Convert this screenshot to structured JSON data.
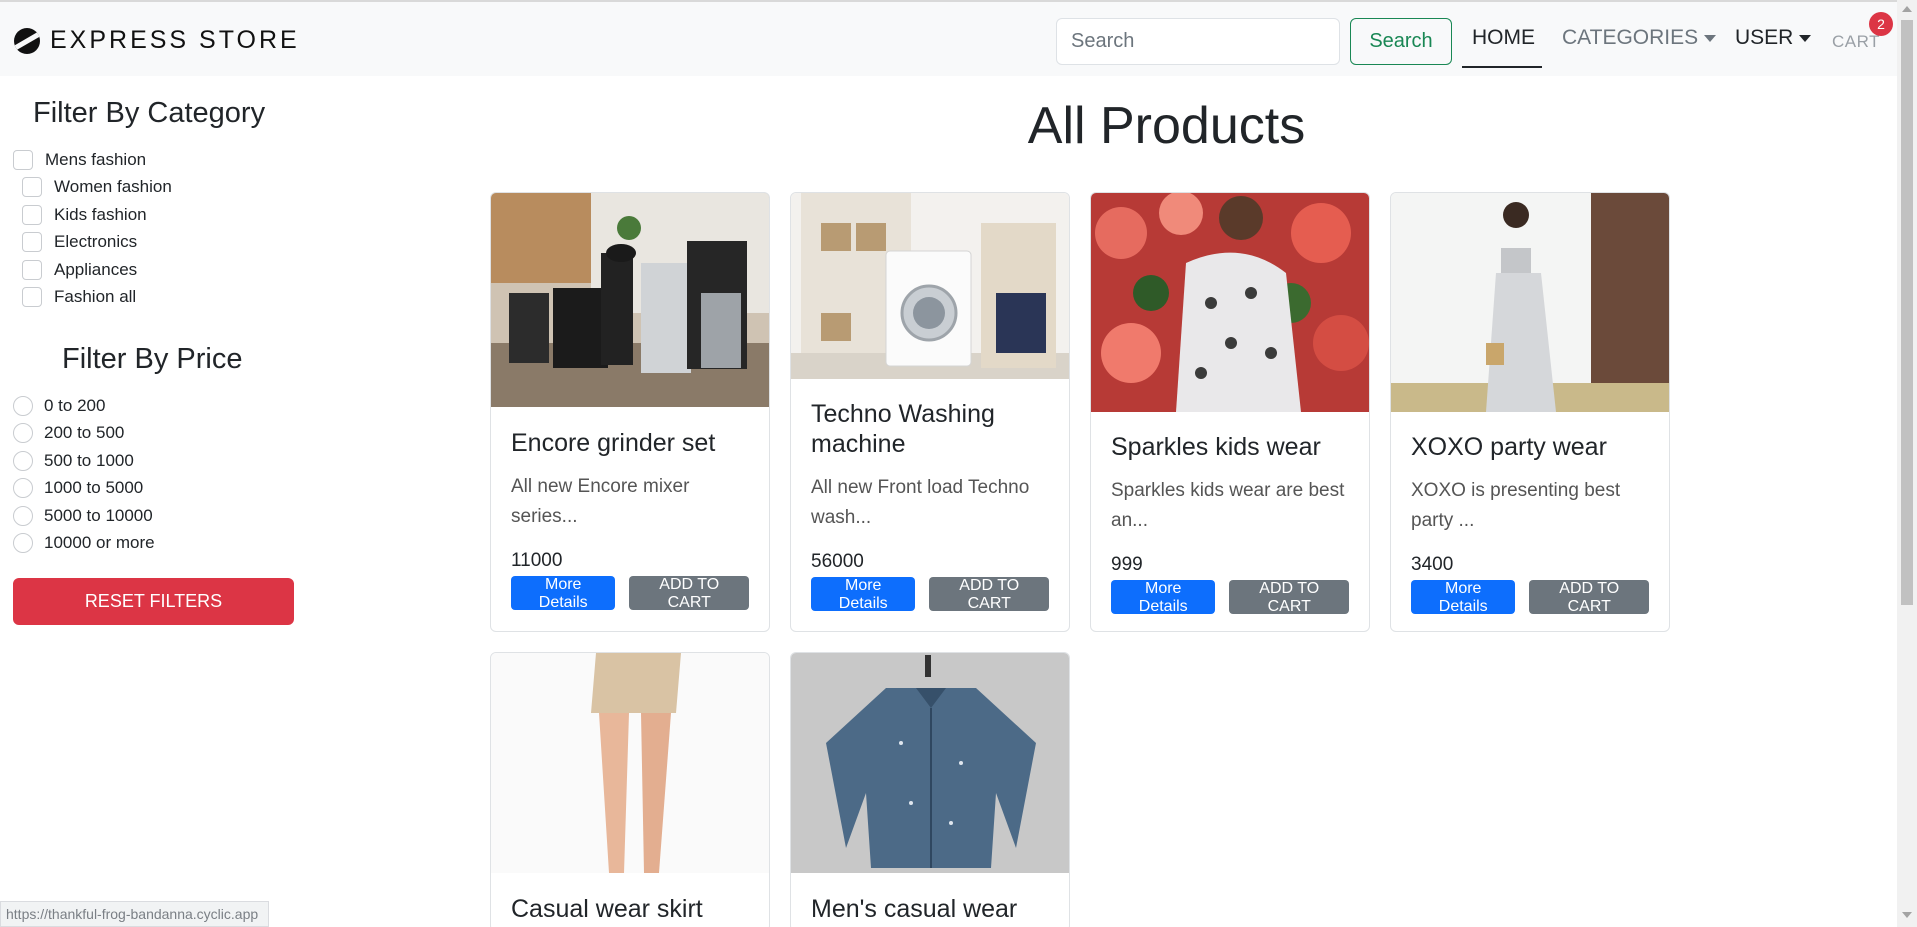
{
  "navbar": {
    "brand": "EXPRESS STORE",
    "search_placeholder": "Search",
    "search_button": "Search",
    "home": "HOME",
    "categories": "CATEGORIES",
    "user": "USER",
    "cart": "CART",
    "cart_count": "2"
  },
  "sidebar": {
    "category_title": "Filter By Category",
    "categories": [
      "Mens fashion",
      "Women fashion",
      "Kids fashion",
      "Electronics",
      "Appliances",
      "Fashion all"
    ],
    "price_title": "Filter By Price",
    "prices": [
      "0 to 200",
      "200 to 500",
      "500 to 1000",
      "1000 to 5000",
      "5000 to 10000",
      "10000 or more"
    ],
    "reset_button": "RESET FILTERS"
  },
  "main": {
    "title": "All Products",
    "details_label": "More Details",
    "cart_label": "ADD TO CART",
    "products": [
      {
        "name": "Encore grinder set",
        "description": "All new Encore mixer series...",
        "price": "11000"
      },
      {
        "name": "Techno Washing machine",
        "description": "All new Front load Techno wash...",
        "price": "56000"
      },
      {
        "name": "Sparkles kids wear",
        "description": "Sparkles kids wear are best an...",
        "price": "999"
      },
      {
        "name": "XOXO party wear",
        "description": "XOXO is presenting best party ...",
        "price": "3400"
      },
      {
        "name": "Casual wear skirt"
      },
      {
        "name": "Men's casual wear"
      }
    ]
  },
  "status_url": "https://thankful-frog-bandanna.cyclic.app",
  "colors": {
    "navbar_bg": "#f8f9fa",
    "search_green": "#198754",
    "badge_red": "#dc3545",
    "primary_blue": "#0d6efd",
    "secondary_gray": "#6c757d"
  }
}
